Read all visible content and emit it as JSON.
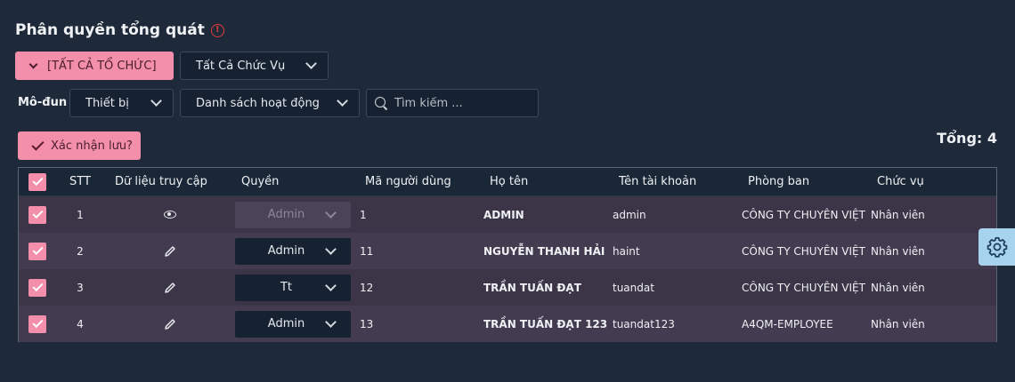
{
  "header": {
    "title": "Phân quyền tổng quát",
    "info_icon": "info-icon",
    "info_glyph": "!"
  },
  "filters": {
    "org_button": "[TẤT CẢ TỔ CHỨC]",
    "position_select": "Tất Cả Chức Vụ",
    "module_label": "Mô-đun",
    "module_select": "Thiết bị",
    "activity_select": "Danh sách hoạt động",
    "search_placeholder": "Tìm kiếm ..."
  },
  "actions": {
    "confirm_save": "Xác nhận lưu?"
  },
  "total": "Tổng: 4",
  "table": {
    "columns": [
      "STT",
      "Dữ liệu truy cập",
      "Quyền",
      "Mã người dùng",
      "Họ tên",
      "Tên tài khoản",
      "Phòng ban",
      "Chức vụ"
    ],
    "rows": [
      {
        "stt": "1",
        "access": "eye-icon",
        "role": "Admin",
        "role_disabled": true,
        "user_code": "1",
        "name": "ADMIN",
        "account": "admin",
        "department": "CÔNG TY CHUYÊN VIỆT",
        "position": "Nhân viên"
      },
      {
        "stt": "2",
        "access": "pencil-icon",
        "role": "Admin",
        "role_disabled": false,
        "user_code": "11",
        "name": "NGUYỄN THANH HẢI",
        "account": "haint",
        "department": "CÔNG TY CHUYÊN VIỆT",
        "position": "Nhân viên"
      },
      {
        "stt": "3",
        "access": "pencil-icon",
        "role": "Tt",
        "role_disabled": false,
        "user_code": "12",
        "name": "TRẦN TUẤN ĐẠT",
        "account": "tuandat",
        "department": "CÔNG TY CHUYÊN VIỆT",
        "position": "Nhân viên"
      },
      {
        "stt": "4",
        "access": "pencil-icon",
        "role": "Admin",
        "role_disabled": false,
        "user_code": "13",
        "name": "TRẦN TUẤN ĐẠT 123",
        "account": "tuandat123",
        "department": "A4QM-EMPLOYEE",
        "position": "Nhân viên"
      }
    ]
  },
  "colors": {
    "background": "#1e2a3a",
    "accent": "#f38fab",
    "settings": "#a7d3ef"
  }
}
